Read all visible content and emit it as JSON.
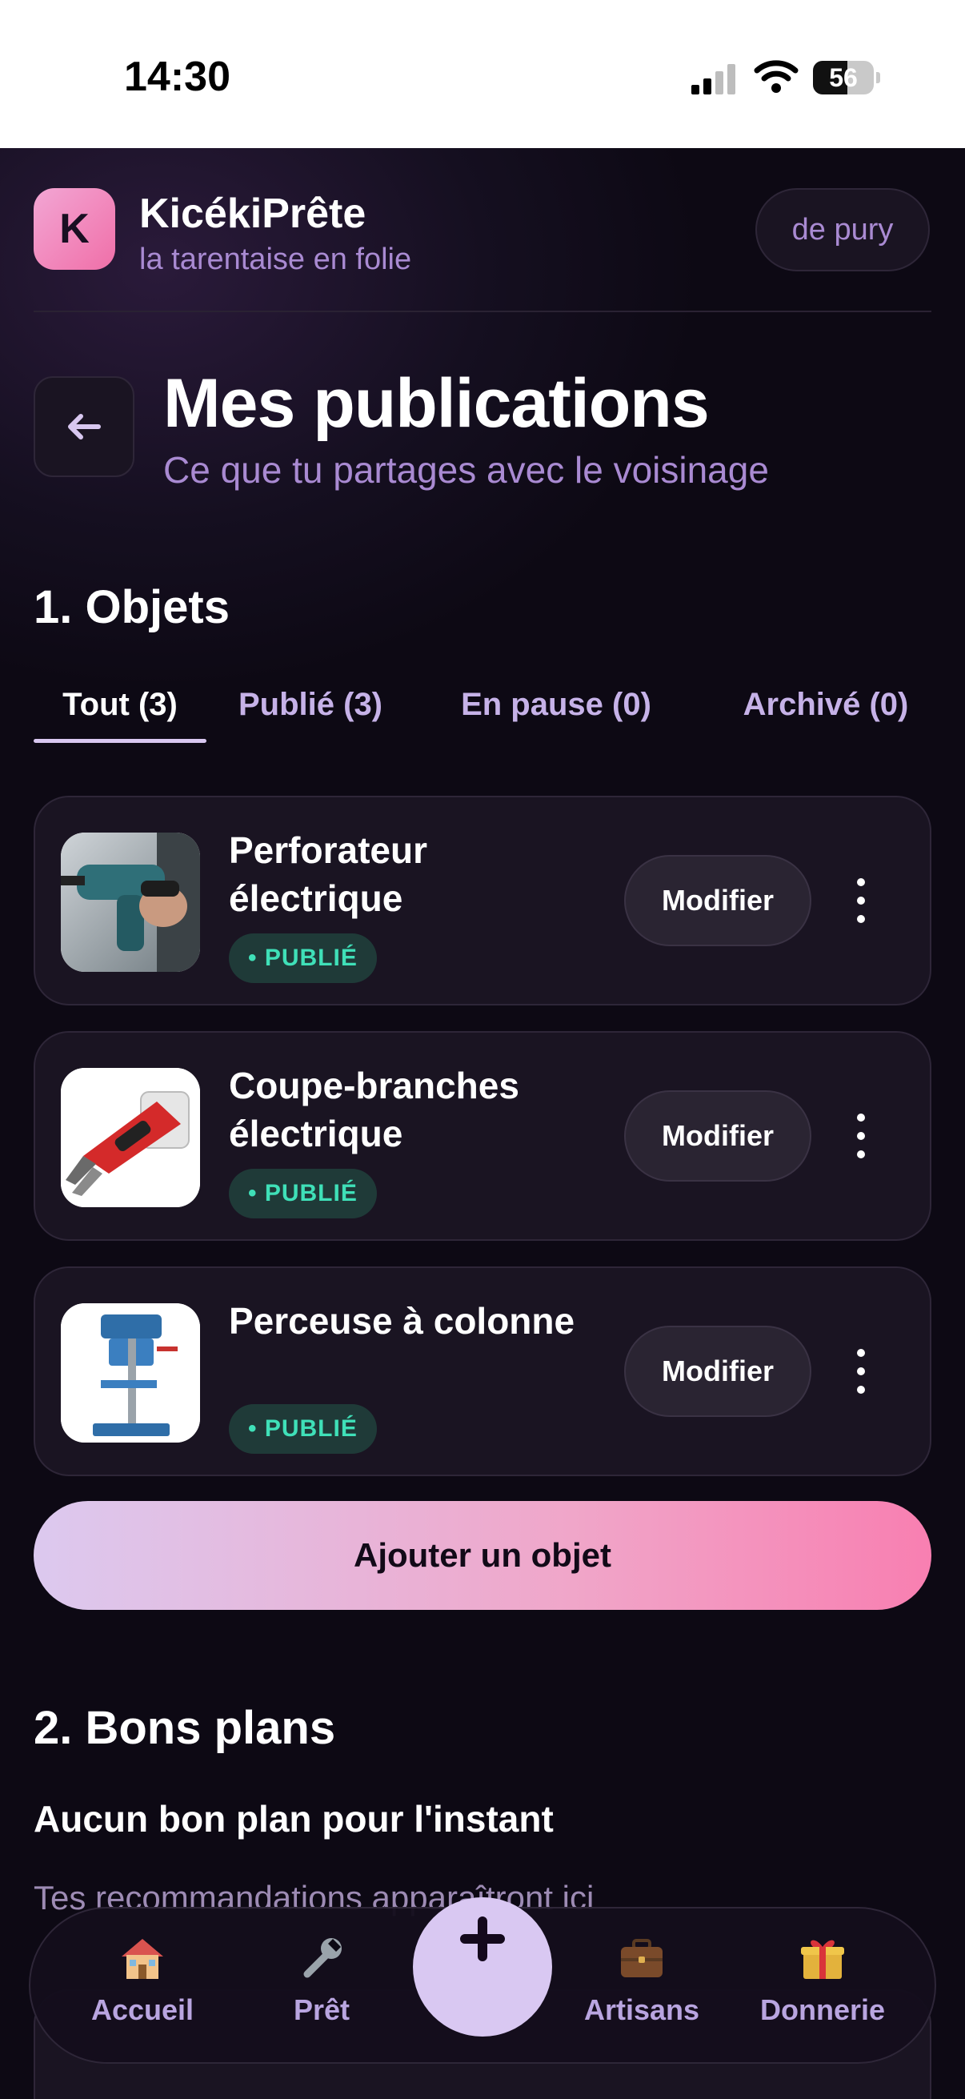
{
  "status_bar": {
    "time": "14:30",
    "battery": "56",
    "battery_level": 0.56
  },
  "header": {
    "logo_letter": "K",
    "brand_name": "KicékiPrête",
    "tagline": "la tarentaise en folie",
    "user": "de pury"
  },
  "page": {
    "title": "Mes publications",
    "subtitle": "Ce que tu partages avec le voisinage"
  },
  "objects_section": {
    "title": "1. Objets",
    "tabs": [
      {
        "label": "Tout (3)",
        "active": true
      },
      {
        "label": "Publié (3)",
        "active": false
      },
      {
        "label": "En pause (0)",
        "active": false
      },
      {
        "label": "Archivé (0)",
        "active": false
      }
    ],
    "items": [
      {
        "title": "Perforateur électrique",
        "status": "• PUBLIÉ",
        "action": "Modifier",
        "icon": "drill-photo"
      },
      {
        "title": "Coupe-branches électrique",
        "status": "• PUBLIÉ",
        "action": "Modifier",
        "icon": "pruner-photo"
      },
      {
        "title": "Perceuse à colonne",
        "status": "• PUBLIÉ",
        "action": "Modifier",
        "icon": "drill-press-photo"
      }
    ],
    "add_button": "Ajouter un objet"
  },
  "deals_section": {
    "title": "2. Bons plans",
    "empty_title": "Aucun bon plan pour l'instant",
    "empty_subtitle": "Tes recommandations apparaîtront ici"
  },
  "bottom_nav": [
    {
      "label": "Accueil",
      "icon": "house-icon"
    },
    {
      "label": "Prêt",
      "icon": "wrench-icon"
    },
    {
      "label": "Artisans",
      "icon": "briefcase-icon"
    },
    {
      "label": "Donnerie",
      "icon": "gift-icon"
    }
  ],
  "colors": {
    "background": "#0d0914",
    "accent_lilac": "#d9c8f2",
    "accent_pink": "#f87fb1",
    "status_green": "#3fe0b8",
    "muted_purple": "#a98ad2"
  }
}
